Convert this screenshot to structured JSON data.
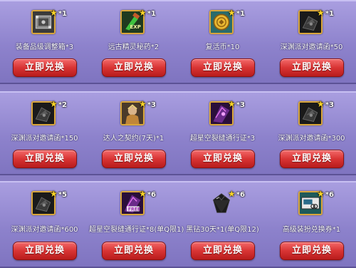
{
  "colors": {
    "panel": "#8d82cc",
    "button": "#d83434",
    "star": "#ffd628",
    "icon_border": "#d9a63b"
  },
  "rows": [
    {
      "items": [
        {
          "icon": "lockbox-icon",
          "badge": "*1",
          "name": "装备品级调整箱*3",
          "button": "立即兑换"
        },
        {
          "icon": "potion-exp-icon",
          "badge": "*1",
          "name": "远古精灵秘药*2",
          "button": "立即兑换"
        },
        {
          "icon": "revive-coin-icon",
          "badge": "*1",
          "name": "复活币*10",
          "button": "立即兑换"
        },
        {
          "icon": "abyss-invitation-icon",
          "badge": "*1",
          "name": "深渊派对邀请函*50",
          "button": "立即兑换"
        }
      ]
    },
    {
      "items": [
        {
          "icon": "abyss-invitation-icon",
          "badge": "*2",
          "name": "深渊派对邀请函*150",
          "button": "立即兑换"
        },
        {
          "icon": "master-contract-icon",
          "badge": "*3",
          "name": "达人之契约(7天)*1",
          "button": "立即兑换"
        },
        {
          "icon": "rift-pass-icon",
          "badge": "*3",
          "name": "超星空裂缝通行证*3",
          "button": "立即兑换"
        },
        {
          "icon": "abyss-invitation-icon",
          "badge": "*3",
          "name": "深渊派对邀请函*300",
          "button": "立即兑换"
        }
      ]
    },
    {
      "items": [
        {
          "icon": "abyss-invitation-icon",
          "badge": "*5",
          "name": "深渊派对邀请函*600",
          "button": "立即兑换"
        },
        {
          "icon": "rift-pass-free-icon",
          "badge": "*6",
          "name": "超星空裂缝通行证*8(单Q限1)",
          "button": "立即兑换"
        },
        {
          "icon": "black-diamond-icon",
          "badge": "*6",
          "name": "黑钻30天*1(单Q限12)",
          "button": "立即兑换"
        },
        {
          "icon": "costume-voucher-icon",
          "badge": "*6",
          "name": "高级装扮兑换券*1",
          "button": "立即兑换"
        }
      ]
    }
  ]
}
